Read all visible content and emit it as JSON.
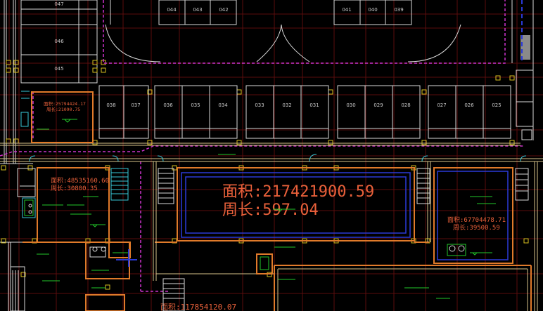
{
  "drawing": {
    "background": "#000000",
    "colors": {
      "grid": "#5a0d0d",
      "wall": "#e07a2a",
      "outline": "#d8c48a",
      "white": "#d9d9d9",
      "magenta": "#cc33cc",
      "cyan": "#38c8d8",
      "blue": "#2a3ad8",
      "green": "#22c82a",
      "yellow": "#d8c020",
      "area_text": "#e8603a"
    },
    "parking_top": [
      "047",
      "046",
      "045"
    ],
    "parking_top_row": [
      "044",
      "043",
      "042"
    ],
    "parking_top_row2": [
      "041",
      "040",
      "039"
    ],
    "parking_middle": [
      "038",
      "037",
      "036",
      "035",
      "034",
      "033",
      "032",
      "031",
      "030",
      "029",
      "028",
      "027",
      "026",
      "025"
    ],
    "room_small": {
      "area": "面积:25794424.17",
      "perimeter": "周长:21090.75"
    },
    "room_left": {
      "area": "面积:48535160.60",
      "perimeter": "周长:30800.35"
    },
    "room_center": {
      "area": "面积:217421900.59",
      "perimeter": "周长:597.04"
    },
    "room_right": {
      "area": "面积:67704478.71",
      "perimeter": "周长:39500.59"
    },
    "room_bottom": {
      "area": "面积:117854120.07"
    }
  }
}
